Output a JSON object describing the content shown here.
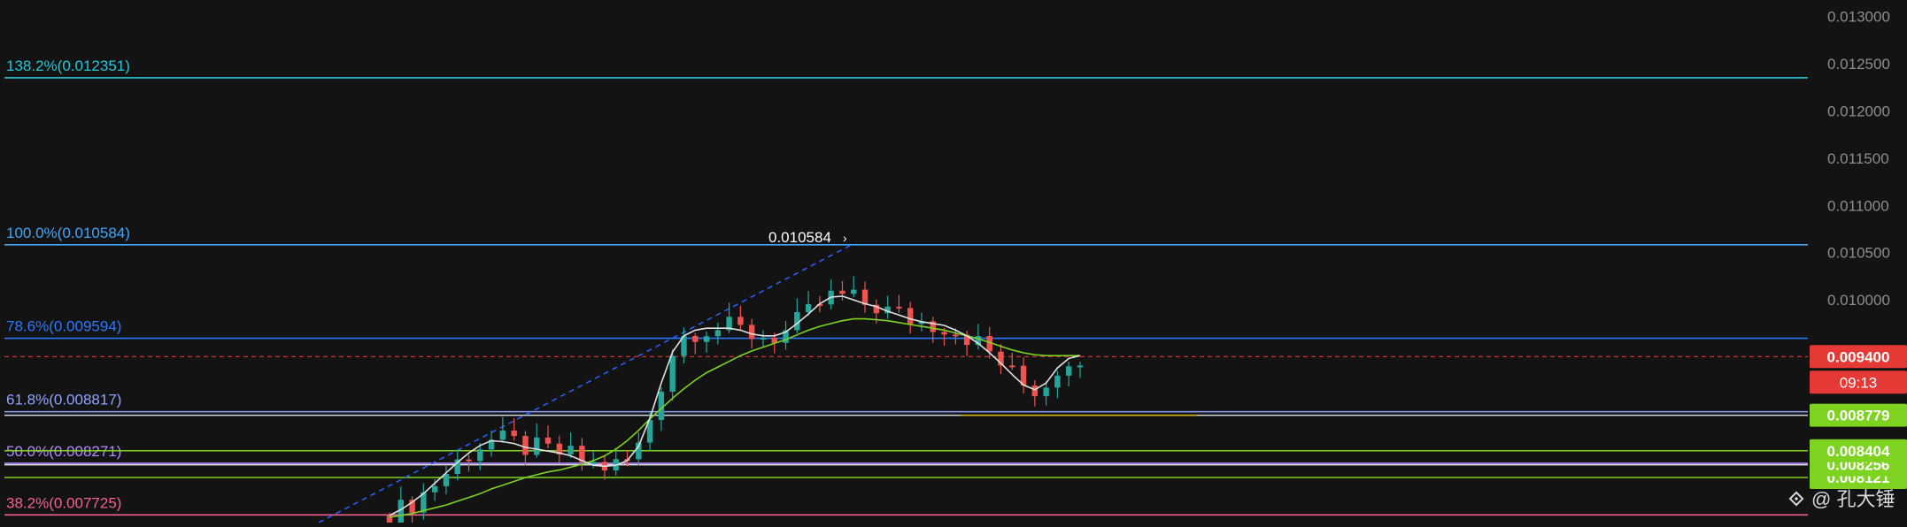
{
  "chart_data": {
    "type": "candlestick",
    "price_axis": {
      "ticks": [
        "0.013000",
        "0.012500",
        "0.012000",
        "0.011500",
        "0.011000",
        "0.010500",
        "0.010000"
      ],
      "ylim": [
        0.0077,
        0.01308
      ]
    },
    "fibonacci": [
      {
        "label": "138.2%(0.012351)",
        "value": 0.012351,
        "color": "#26c6da"
      },
      {
        "label": "100.0%(0.010584)",
        "value": 0.010584,
        "color": "#42a5f5"
      },
      {
        "label": "78.6%(0.009594)",
        "value": 0.009594,
        "color": "#2979ff"
      },
      {
        "label": "61.8%(0.008817)",
        "value": 0.008817,
        "color": "#90a4ff"
      },
      {
        "label": "50.0%(0.008271)",
        "value": 0.008271,
        "color": "#b388ff"
      },
      {
        "label": "38.2%(0.007725)",
        "value": 0.007725,
        "color": "#f06292"
      }
    ],
    "high_marker": {
      "label": "0.010584",
      "value": 0.010584
    },
    "current_price": {
      "label": "0.009400",
      "value": 0.0094,
      "countdown": "09:13",
      "color": "#e53935"
    },
    "price_badges": [
      {
        "label": "0.008779",
        "value": 0.008779,
        "color": "#7ed321"
      },
      {
        "label": "0.008404",
        "value": 0.008404,
        "color": "#7ed321"
      },
      {
        "label": "0.008256",
        "value": 0.008256,
        "color": "#7ed321"
      },
      {
        "label": "0.008121",
        "value": 0.008121,
        "color": "#7ed321"
      }
    ],
    "horizontal_lines": [
      {
        "value": 0.008779,
        "color": "#cfd8dc"
      },
      {
        "value": 0.008404,
        "color": "#7ed321"
      },
      {
        "value": 0.008256,
        "color": "#e0e0e0"
      },
      {
        "value": 0.008121,
        "color": "#7ed321"
      }
    ],
    "ma_fast_values": [
      0.00772,
      0.00778,
      0.00786,
      0.00795,
      0.00806,
      0.00817,
      0.00828,
      0.00838,
      0.00846,
      0.00851,
      0.0085,
      0.00848,
      0.00844,
      0.00842,
      0.0084,
      0.00838,
      0.00835,
      0.0083,
      0.00825,
      0.00824,
      0.00825,
      0.0083,
      0.00845,
      0.00875,
      0.00912,
      0.00945,
      0.00962,
      0.00968,
      0.0097,
      0.0097,
      0.0097,
      0.00968,
      0.00964,
      0.00962,
      0.00962,
      0.00966,
      0.00975,
      0.00985,
      0.00996,
      0.01003,
      0.01004,
      0.01,
      0.00996,
      0.00993,
      0.00988,
      0.00984,
      0.0098,
      0.00977,
      0.00975,
      0.00973,
      0.00968,
      0.00962,
      0.00954,
      0.00944,
      0.00933,
      0.00921,
      0.0091,
      0.00905,
      0.00912,
      0.00928,
      0.00938,
      0.00941
    ],
    "ma_slow_values": [
      0.0077,
      0.00772,
      0.00774,
      0.00777,
      0.0078,
      0.00783,
      0.00787,
      0.00791,
      0.00795,
      0.008,
      0.00804,
      0.00808,
      0.00812,
      0.00815,
      0.00818,
      0.0082,
      0.00823,
      0.00826,
      0.0083,
      0.00835,
      0.00842,
      0.00851,
      0.00862,
      0.00874,
      0.00885,
      0.00896,
      0.00906,
      0.00915,
      0.00923,
      0.00929,
      0.00935,
      0.00941,
      0.00946,
      0.0095,
      0.00954,
      0.00958,
      0.00963,
      0.00968,
      0.00972,
      0.00975,
      0.00978,
      0.0098,
      0.0098,
      0.00979,
      0.00978,
      0.00976,
      0.00974,
      0.00972,
      0.0097,
      0.00968,
      0.00965,
      0.00962,
      0.00959,
      0.00955,
      0.00951,
      0.00947,
      0.00944,
      0.00942,
      0.00941,
      0.00941,
      0.00941,
      0.00941
    ]
  },
  "watermark": {
    "text": "@ 孔大锤"
  },
  "colors": {
    "up": "#26a69a",
    "down": "#ef5350",
    "ma_fast": "#e0e0e0",
    "ma_slow": "#7ed321",
    "low_marker": "#d4b106",
    "trend_line": "#2962ff"
  }
}
